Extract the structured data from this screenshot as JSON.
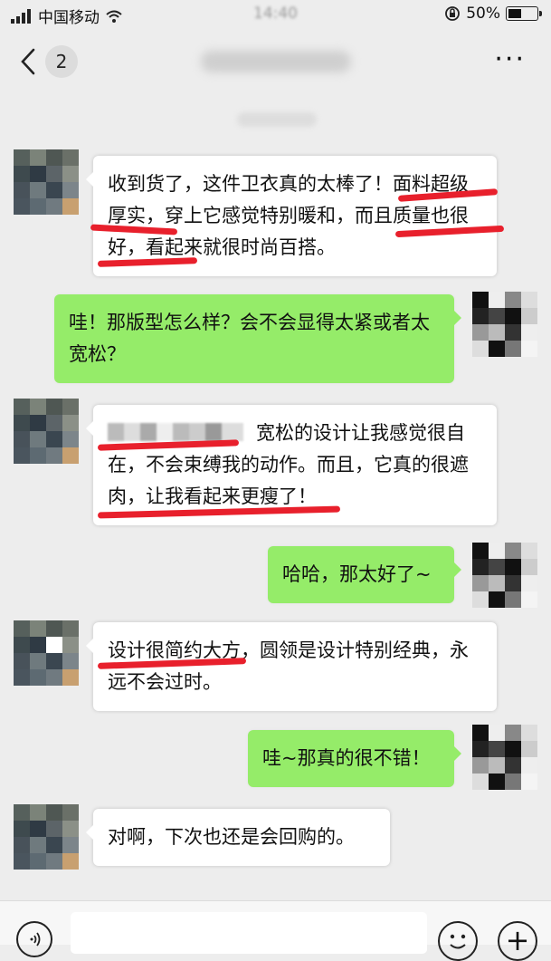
{
  "status_bar": {
    "carrier": "中国移动",
    "time": "14:40",
    "battery": "50%",
    "battery_level": 0.5
  },
  "nav": {
    "badge_count": "2",
    "back_icon": "chevron-left-icon",
    "more_icon": "more-dots-icon",
    "more_label": "···"
  },
  "messages": [
    {
      "side": "left",
      "text": "收到货了，这件卫衣真的太棒了！面料超级厚实，穿上它感觉特别暖和，而且质量也很好，看起来就很时尚百搭。"
    },
    {
      "side": "right",
      "text": "哇！那版型怎么样？会不会显得太紧或者太宽松？"
    },
    {
      "side": "left",
      "text": "宽松的设计让我感觉很自在，不会束缚我的动作。而且，它真的很遮肉，让我看起来更瘦了！"
    },
    {
      "side": "right",
      "text": "哈哈，那太好了~"
    },
    {
      "side": "left",
      "text": "设计很简约大方，圆领是设计特别经典，永远不会过时。"
    },
    {
      "side": "right",
      "text": "哇~那真的很不错！"
    },
    {
      "side": "left",
      "text": "对啊，下次也还是会回购的。"
    }
  ],
  "input_bar": {
    "voice_icon": "voice-icon",
    "emoji_icon": "emoji-icon",
    "plus_icon": "plus-icon",
    "plus_label": "+"
  },
  "colors": {
    "background": "#ededed",
    "bubble_self": "#95ec69",
    "bubble_other": "#ffffff",
    "highlight": "#e8202c"
  }
}
